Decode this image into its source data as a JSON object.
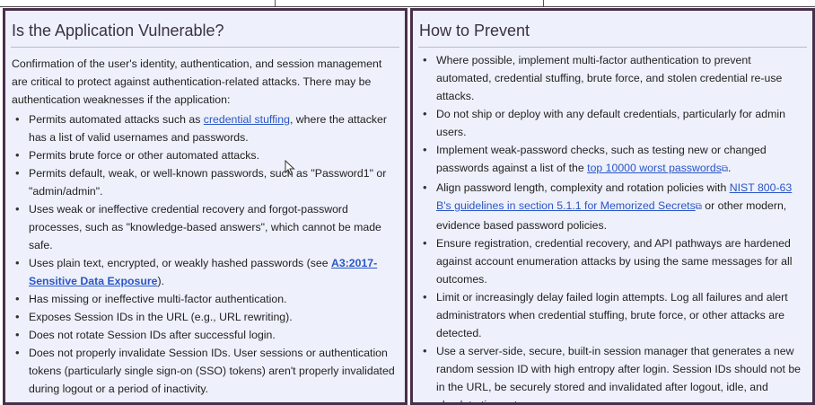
{
  "left": {
    "title": "Is the Application Vulnerable?",
    "intro": "Confirmation of the user's identity, authentication, and session management are critical to protect against authentication-related attacks. There may be authentication weaknesses if the application:",
    "items": {
      "i0": {
        "before": "Permits automated attacks such as ",
        "link": "credential stuffing",
        "after": ", where the attacker has a list of valid usernames and passwords."
      },
      "i1": {
        "text": "Permits brute force or other automated attacks."
      },
      "i2": {
        "text": "Permits default, weak, or well-known passwords, such as \"Password1\" or \"admin/admin\"."
      },
      "i3": {
        "text": "Uses weak or ineffective credential recovery and forgot-password processes, such as \"knowledge-based answers\", which cannot be made safe."
      },
      "i4": {
        "before": "Uses plain text, encrypted, or weakly hashed passwords (see ",
        "link": "A3:2017-Sensitive Data Exposure",
        "after": ")."
      },
      "i5": {
        "text": "Has missing or ineffective multi-factor authentication."
      },
      "i6": {
        "text": "Exposes Session IDs in the URL (e.g., URL rewriting)."
      },
      "i7": {
        "text": "Does not rotate Session IDs after successful login."
      },
      "i8": {
        "text": "Does not properly invalidate Session IDs. User sessions or authentication tokens (particularly single sign-on (SSO) tokens) aren't properly invalidated during logout or a period of inactivity."
      }
    }
  },
  "right": {
    "title": "How to Prevent",
    "items": {
      "i0": {
        "text": "Where possible, implement multi-factor authentication to prevent automated, credential stuffing, brute force, and stolen credential re-use attacks."
      },
      "i1": {
        "text": "Do not ship or deploy with any default credentials, particularly for admin users."
      },
      "i2": {
        "before": "Implement weak-password checks, such as testing new or changed passwords against a list of the ",
        "link": "top 10000 worst passwords",
        "after": "."
      },
      "i3": {
        "before": "Align password length, complexity and rotation policies with ",
        "link": "NIST 800-63 B's guidelines in section 5.1.1 for Memorized Secrets",
        "after": " or other modern, evidence based password policies."
      },
      "i4": {
        "text": "Ensure registration, credential recovery, and API pathways are hardened against account enumeration attacks by using the same messages for all outcomes."
      },
      "i5": {
        "text": "Limit or increasingly delay failed login attempts. Log all failures and alert administrators when credential stuffing, brute force, or other attacks are detected."
      },
      "i6": {
        "text": "Use a server-side, secure, built-in session manager that generates a new random session ID with high entropy after login. Session IDs should not be in the URL, be securely stored and invalidated after logout, idle, and absolute timeouts."
      }
    }
  },
  "icons": {
    "external_link": "external-link-icon",
    "cursor": "mouse-pointer-icon"
  },
  "colors": {
    "panel_bg": "#eef0fb",
    "border": "#4a2f4a",
    "link": "#2a56c6"
  }
}
